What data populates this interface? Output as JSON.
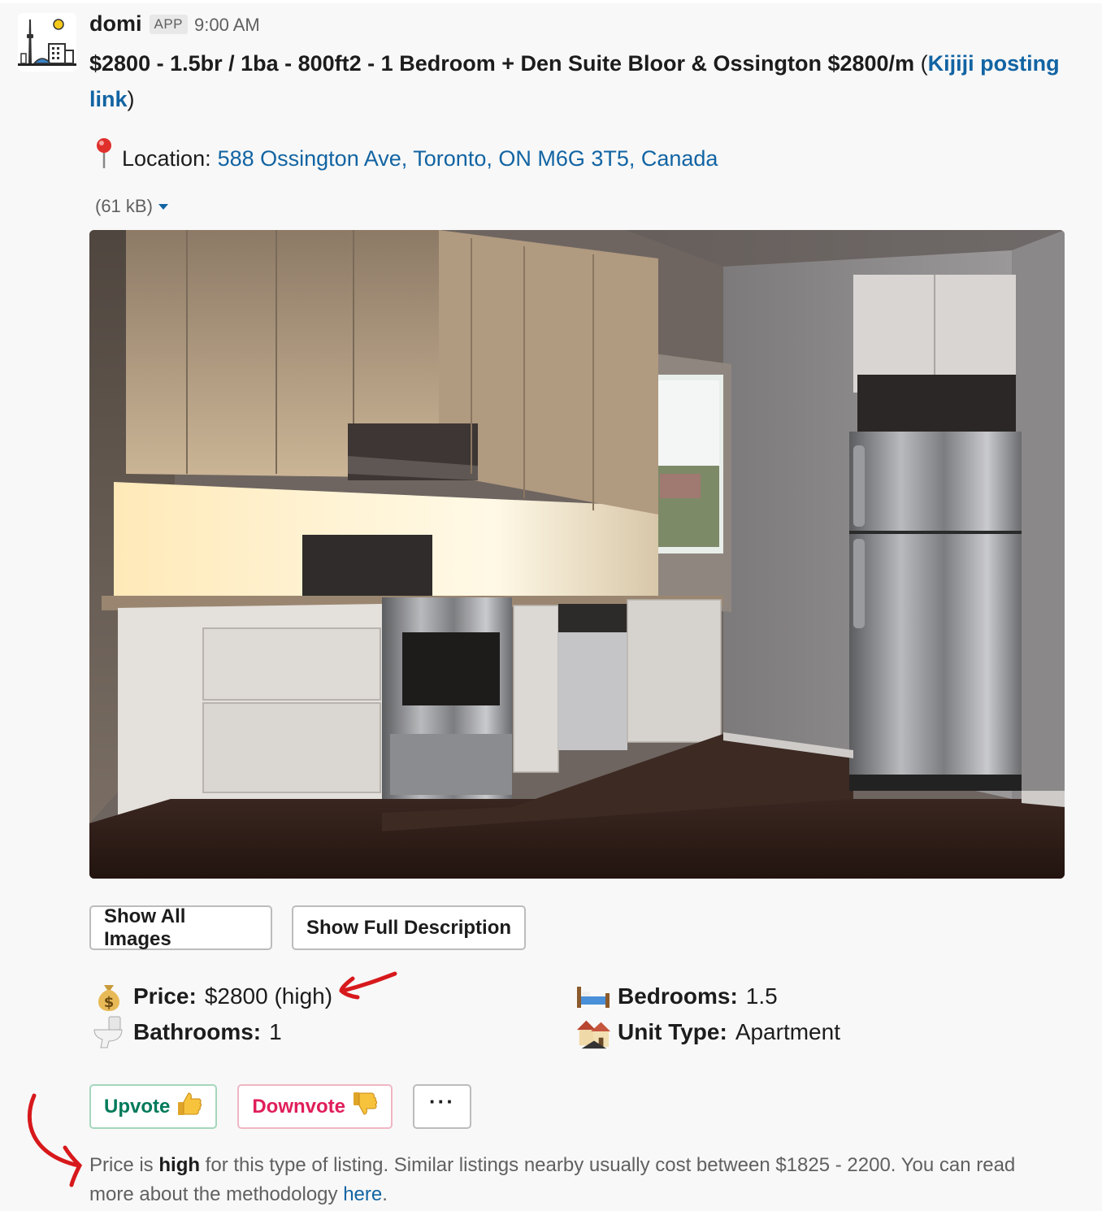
{
  "message": {
    "sender": "domi",
    "badge": "APP",
    "time": "9:00 AM",
    "title_text": "$2800 - 1.5br / 1ba - 800ft2 - 1 Bedroom + Den Suite Bloor & Ossington $2800/m ",
    "title_paren_open": "(",
    "title_link": "Kijiji posting link",
    "title_paren_close": ")"
  },
  "location": {
    "icon": "round-pushpin-icon",
    "label": "Location:",
    "value": "588 Ossington Ave, Toronto, ON M6G 3T5, Canada"
  },
  "attachment": {
    "size": "(61 kB)"
  },
  "buttons": {
    "show_images": "Show All Images",
    "show_description": "Show Full Description"
  },
  "fields": {
    "price": {
      "label": "Price:",
      "value": "$2800 (high)",
      "icon": "money-bag-icon"
    },
    "bedrooms": {
      "label": "Bedrooms:",
      "value": "1.5",
      "icon": "bed-icon"
    },
    "bathrooms": {
      "label": "Bathrooms:",
      "value": "1",
      "icon": "toilet-icon"
    },
    "unit_type": {
      "label": "Unit Type:",
      "value": "Apartment",
      "icon": "houses-icon"
    }
  },
  "actions": {
    "upvote": "Upvote",
    "downvote": "Downvote",
    "more": "···"
  },
  "note": {
    "p1": "Price is ",
    "strong": "high",
    "p2": " for this type of listing. Similar listings nearby usually cost between $1825 - 2200. You can read more about the methodology ",
    "link": "here",
    "p3": "."
  },
  "colors": {
    "link": "#1264a3",
    "upvote": "#007a5a",
    "downvote": "#e01e5a",
    "annotation": "#d7191c"
  }
}
